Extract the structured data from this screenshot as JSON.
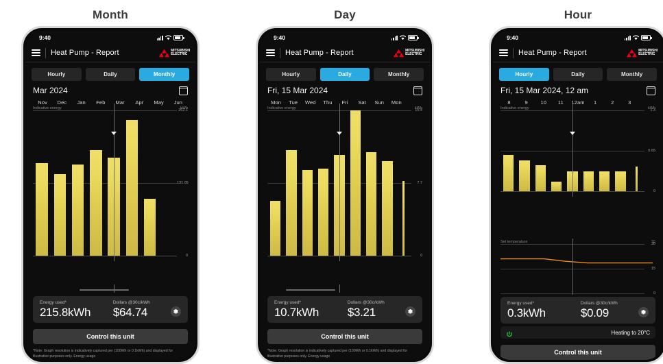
{
  "panels": [
    {
      "heading": "Month",
      "status": {
        "time": "9:40"
      },
      "appbar": {
        "title": "Heat Pump - Report",
        "logo_line1": "MITSUBISHI",
        "logo_line2": "ELECTRIC"
      },
      "tabs": [
        {
          "label": "Hourly",
          "active": false
        },
        {
          "label": "Daily",
          "active": false
        },
        {
          "label": "Monthly",
          "active": true
        }
      ],
      "date": "Mar 2024",
      "chart_caption": "Indicative energy",
      "summary": {
        "energy_label": "Energy used*",
        "energy_value": "215.8kWh",
        "dollars_label": "Dollars @30c/kWh",
        "dollars_value": "$64.74"
      },
      "control_label": "Control this unit",
      "note": "*Note: Graph resolution is indicatively captured per (100Wh or 0.1kWh) and displayed for illustrative purposes only. Energy usage",
      "has_status_row": false,
      "chart_data": {
        "type": "bar",
        "title": "Indicative energy",
        "ylabel": "kWh",
        "categories": [
          "Nov",
          "Dec",
          "Jan",
          "Feb",
          "Mar",
          "Apr",
          "May",
          "Jun"
        ],
        "values": [
          167,
          147,
          164,
          190,
          177,
          245,
          103,
          0
        ],
        "ylim": [
          0,
          262.1
        ],
        "yticks": [
          "262.1",
          "131.05",
          "0"
        ],
        "cursor_category": "Mar",
        "grid": true
      }
    },
    {
      "heading": "Day",
      "status": {
        "time": "9:40"
      },
      "appbar": {
        "title": "Heat Pump - Report",
        "logo_line1": "MITSUBISHI",
        "logo_line2": "ELECTRIC"
      },
      "tabs": [
        {
          "label": "Hourly",
          "active": false
        },
        {
          "label": "Daily",
          "active": true
        },
        {
          "label": "Monthly",
          "active": false
        }
      ],
      "date": "Fri, 15 Mar 2024",
      "chart_caption": "Indicative energy",
      "summary": {
        "energy_label": "Energy used*",
        "energy_value": "10.7kWh",
        "dollars_label": "Dollars @30c/kWh",
        "dollars_value": "$3.21"
      },
      "control_label": "Control this unit",
      "note": "*Note: Graph resolution is indicatively captured per (100Wh or 0.1kWh) and displayed for illustrative purposes only. Energy usage",
      "has_status_row": false,
      "chart_data": {
        "type": "bar",
        "title": "Indicative energy",
        "ylabel": "kWh",
        "categories": [
          "Mon",
          "Tue",
          "Wed",
          "Thu",
          "Fri",
          "Sat",
          "Sun",
          "Mon",
          ""
        ],
        "values": [
          5.8,
          11.2,
          9.1,
          9.2,
          10.7,
          15.4,
          11.0,
          10.0,
          7.9
        ],
        "ylim": [
          0,
          15.4
        ],
        "yticks": [
          "15.4",
          "7.7",
          "0"
        ],
        "cursor_category": "Fri",
        "grid": true
      }
    },
    {
      "heading": "Hour",
      "status": {
        "time": "9:40"
      },
      "appbar": {
        "title": "Heat Pump - Report",
        "logo_line1": "MITSUBISHI",
        "logo_line2": "ELECTRIC"
      },
      "tabs": [
        {
          "label": "Hourly",
          "active": true
        },
        {
          "label": "Daily",
          "active": false
        },
        {
          "label": "Monthly",
          "active": false
        }
      ],
      "date": "Fri, 15 Mar 2024, 12 am",
      "chart_caption": "Indicative energy",
      "temp_caption": "Set temperature",
      "temp_unit": "°C",
      "summary": {
        "energy_label": "Energy used*",
        "energy_value": "0.3kWh",
        "dollars_label": "Dollars @30c/kWh",
        "dollars_value": "$0.09"
      },
      "status_row": {
        "text": "Heating to 20°C",
        "icon_color": "#27c93f"
      },
      "control_label": "Control this unit",
      "note": "",
      "has_status_row": true,
      "chart_data": {
        "type": "bar",
        "title": "Indicative energy",
        "ylabel": "kWh",
        "categories": [
          "8",
          "9",
          "10",
          "11",
          "12am",
          "1",
          "2",
          "3",
          ""
        ],
        "values": [
          0.58,
          0.5,
          0.42,
          0.15,
          0.32,
          0.32,
          0.32,
          0.32,
          0.4
        ],
        "ylim": [
          0,
          1.3
        ],
        "yticks": [
          "1.3",
          "0.65",
          "0"
        ],
        "cursor_category": "12am",
        "grid": true
      },
      "temp_chart": {
        "type": "line",
        "title": "Set temperature",
        "ylabel": "°C",
        "yticks": [
          "30",
          "15",
          "0"
        ],
        "ylim": [
          0,
          30
        ],
        "x": [
          "8",
          "9",
          "10",
          "11",
          "12am",
          "1",
          "2",
          "3"
        ],
        "values": [
          21,
          21,
          21,
          19.5,
          18.5,
          18.5,
          18.5,
          18.5
        ],
        "color": "#f0900a"
      }
    }
  ],
  "colors": {
    "accent": "#29ABE2",
    "bar": "#e5d45a",
    "brand_red": "#e60012",
    "temp_line": "#f0900a",
    "power_green": "#27c93f"
  }
}
